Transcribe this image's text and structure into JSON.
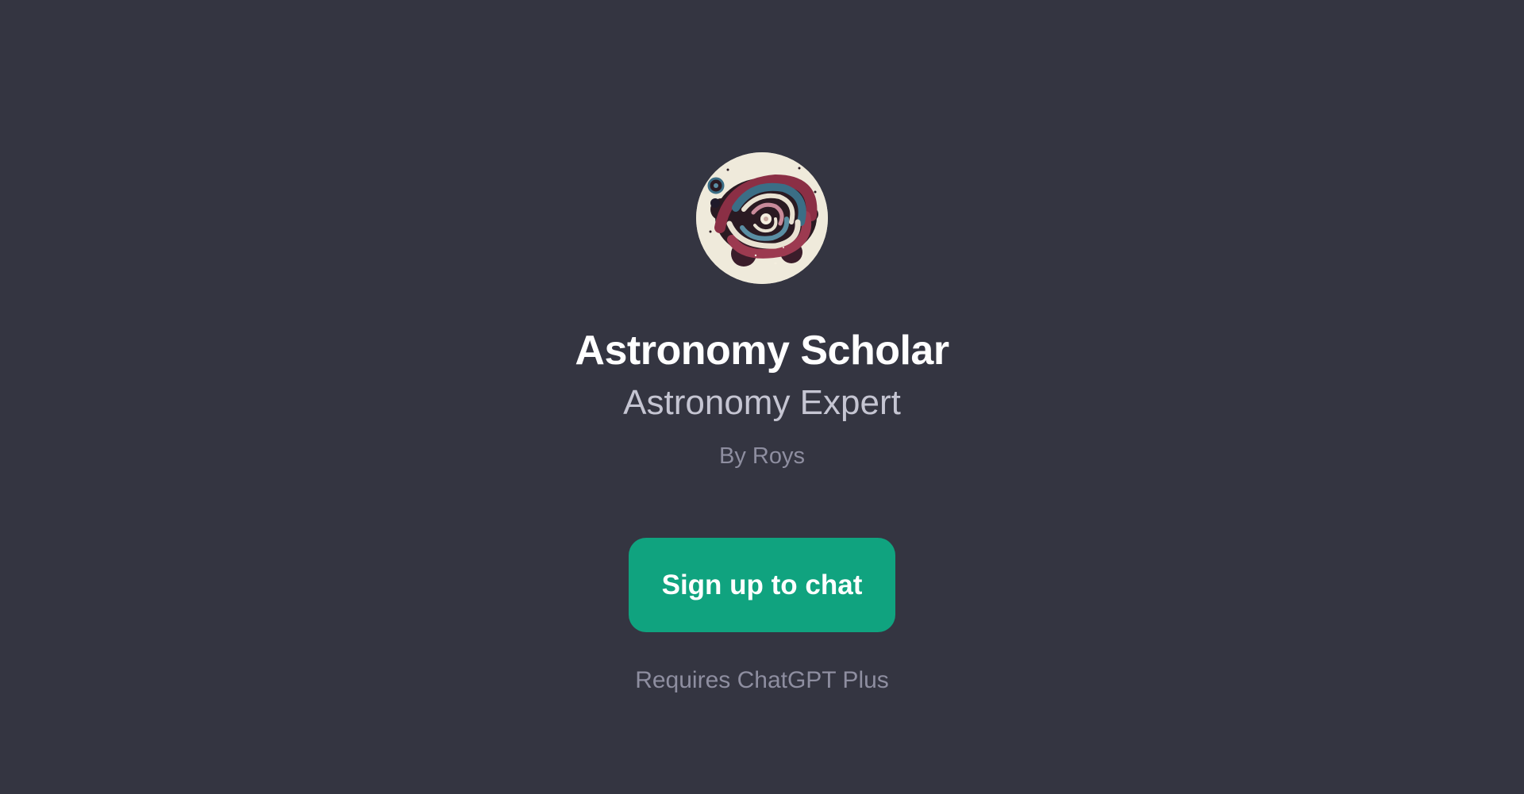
{
  "app": {
    "background_color": "#343541",
    "accent_color": "#10a37f"
  },
  "profile": {
    "avatar_icon": "spiral-galaxy-avatar",
    "name": "Astronomy Scholar",
    "tagline": "Astronomy Expert",
    "author": "By Roys"
  },
  "actions": {
    "signup_label": "Sign up to chat",
    "requirement_note": "Requires ChatGPT Plus"
  }
}
